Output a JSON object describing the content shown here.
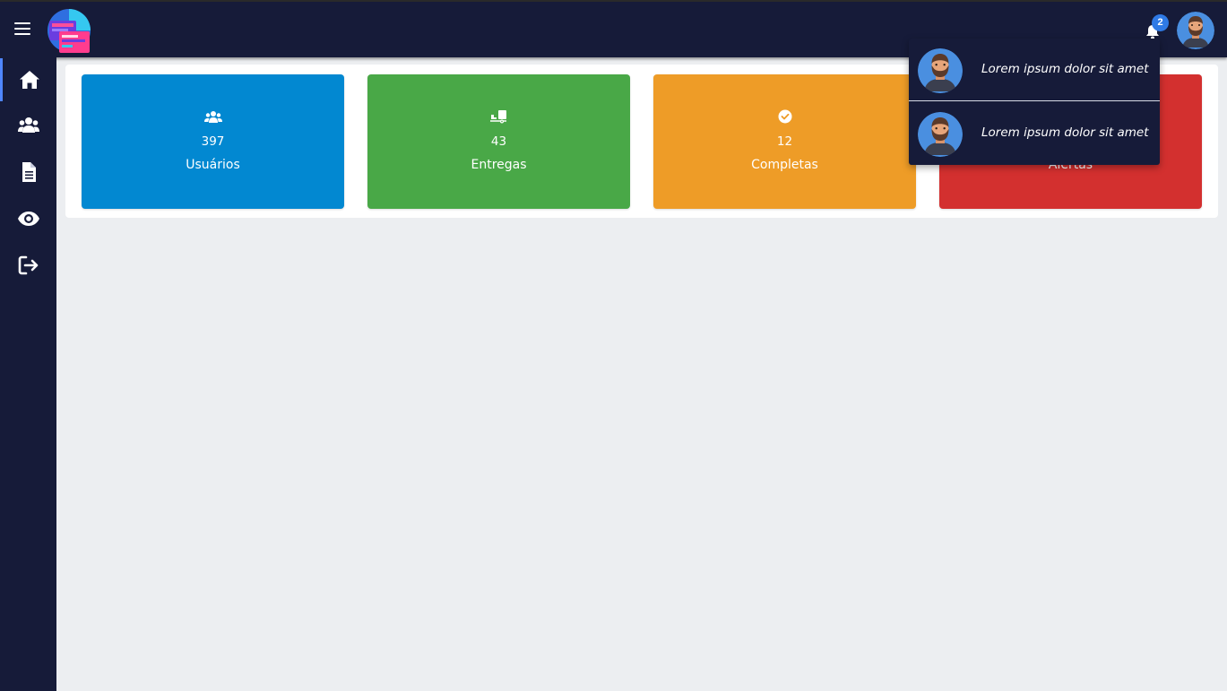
{
  "header": {
    "menu_icon": "hamburger-icon",
    "logo_icon": "app-logo",
    "notification_icon": "bell-icon",
    "notification_count": "2",
    "avatar_icon": "user-avatar"
  },
  "sidebar": {
    "items": [
      {
        "icon": "home-icon",
        "active": true
      },
      {
        "icon": "users-icon",
        "active": false
      },
      {
        "icon": "document-icon",
        "active": false
      },
      {
        "icon": "eye-icon",
        "active": false
      },
      {
        "icon": "logout-icon",
        "active": false
      }
    ]
  },
  "cards": [
    {
      "icon": "users-icon",
      "value": "397",
      "label": "Usuários",
      "color": "#0288d1"
    },
    {
      "icon": "delivery-icon",
      "value": "43",
      "label": "Entregas",
      "color": "#49a847"
    },
    {
      "icon": "check-circle-icon",
      "value": "12",
      "label": "Completas",
      "color": "#ee9c27"
    },
    {
      "icon": "alert-icon",
      "value": "",
      "label": "Alertas",
      "color": "#d3302f"
    }
  ],
  "notifications": [
    {
      "text": "Lorem ipsum dolor sit amet"
    },
    {
      "text": "Lorem ipsum dolor sit amet"
    }
  ],
  "colors": {
    "navy": "#161b39",
    "background": "#eceef1",
    "accent": "#2f7ae5"
  }
}
